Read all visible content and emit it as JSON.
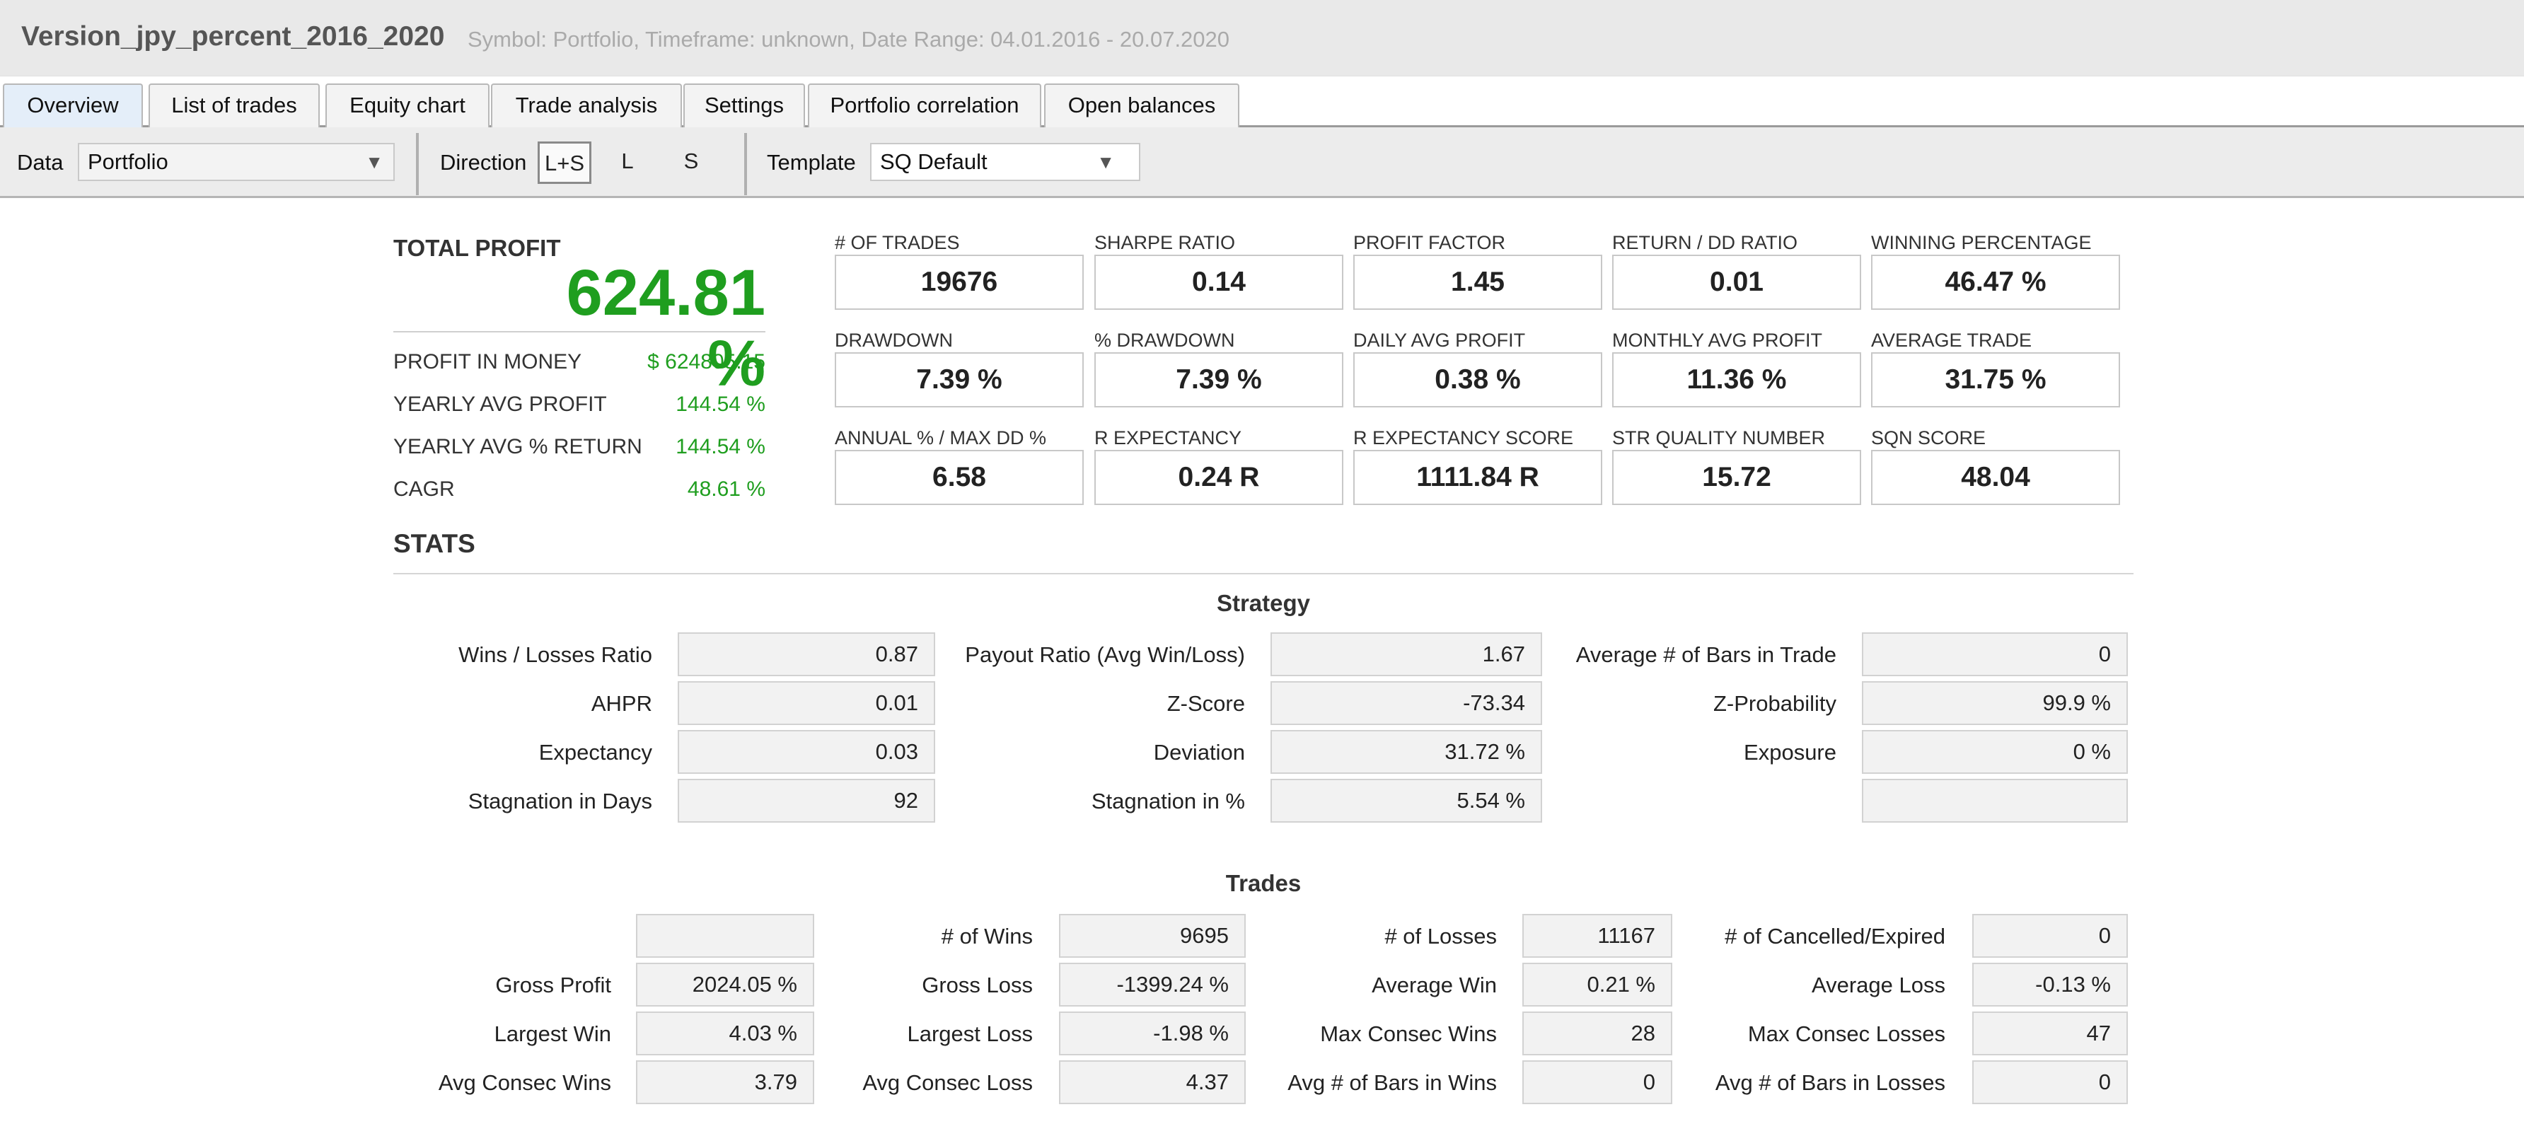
{
  "title": {
    "main": "Version_jpy_percent_2016_2020",
    "subtitle": "Symbol: Portfolio, Timeframe: unknown, Date Range: 04.01.2016 - 20.07.2020"
  },
  "tabs": [
    {
      "label": "Overview",
      "active": true
    },
    {
      "label": "List of trades",
      "active": false
    },
    {
      "label": "Equity chart",
      "active": false
    },
    {
      "label": "Trade analysis",
      "active": false
    },
    {
      "label": "Settings",
      "active": false
    },
    {
      "label": "Portfolio correlation",
      "active": false
    },
    {
      "label": "Open balances",
      "active": false
    }
  ],
  "toolbar": {
    "data_label": "Data",
    "data_value": "Portfolio",
    "direction_label": "Direction",
    "direction_options": [
      "L+S",
      "L",
      "S"
    ],
    "direction_selected": "L+S",
    "template_label": "Template",
    "template_value": "SQ Default",
    "arrow_glyph": "▼"
  },
  "summary": {
    "total_profit_label": "TOTAL PROFIT",
    "total_profit_value": "624.81 %",
    "rows": [
      {
        "label": "PROFIT IN MONEY",
        "value": "$ 624805.15"
      },
      {
        "label": "YEARLY AVG PROFIT",
        "value": "144.54 %"
      },
      {
        "label": "YEARLY AVG % RETURN",
        "value": "144.54 %"
      },
      {
        "label": "CAGR",
        "value": "48.61 %"
      }
    ]
  },
  "metrics": [
    {
      "label": "# OF TRADES",
      "value": "19676"
    },
    {
      "label": "SHARPE RATIO",
      "value": "0.14"
    },
    {
      "label": "PROFIT FACTOR",
      "value": "1.45"
    },
    {
      "label": "RETURN / DD RATIO",
      "value": "0.01"
    },
    {
      "label": "WINNING PERCENTAGE",
      "value": "46.47 %"
    },
    {
      "label": "DRAWDOWN",
      "value": "7.39 %"
    },
    {
      "label": "% DRAWDOWN",
      "value": "7.39 %"
    },
    {
      "label": "DAILY AVG PROFIT",
      "value": "0.38 %"
    },
    {
      "label": "MONTHLY AVG PROFIT",
      "value": "11.36 %"
    },
    {
      "label": "AVERAGE TRADE",
      "value": "31.75 %"
    },
    {
      "label": "ANNUAL % / MAX DD %",
      "value": "6.58"
    },
    {
      "label": "R EXPECTANCY",
      "value": "0.24 R"
    },
    {
      "label": "R EXPECTANCY SCORE",
      "value": "1111.84 R"
    },
    {
      "label": "STR QUALITY NUMBER",
      "value": "15.72"
    },
    {
      "label": "SQN SCORE",
      "value": "48.04"
    }
  ],
  "stats": {
    "title": "STATS",
    "strategy": {
      "title": "Strategy",
      "rows": [
        [
          {
            "label": "Wins / Losses Ratio",
            "value": "0.87"
          },
          {
            "label": "Payout Ratio (Avg Win/Loss)",
            "value": "1.67"
          },
          {
            "label": "Average # of Bars in Trade",
            "value": "0"
          }
        ],
        [
          {
            "label": "AHPR",
            "value": "0.01"
          },
          {
            "label": "Z-Score",
            "value": "-73.34"
          },
          {
            "label": "Z-Probability",
            "value": "99.9 %"
          }
        ],
        [
          {
            "label": "Expectancy",
            "value": "0.03"
          },
          {
            "label": "Deviation",
            "value": "31.72 %"
          },
          {
            "label": "Exposure",
            "value": "0 %"
          }
        ],
        [
          {
            "label": "Stagnation in Days",
            "value": "92"
          },
          {
            "label": "Stagnation in %",
            "value": "5.54 %"
          },
          {
            "label": "",
            "value": ""
          }
        ]
      ]
    },
    "trades": {
      "title": "Trades",
      "rows": [
        [
          {
            "label": "",
            "value": ""
          },
          {
            "label": "# of Wins",
            "value": "9695"
          },
          {
            "label": "# of Losses",
            "value": "11167"
          },
          {
            "label": "# of Cancelled/Expired",
            "value": "0"
          }
        ],
        [
          {
            "label": "Gross Profit",
            "value": "2024.05 %"
          },
          {
            "label": "Gross Loss",
            "value": "-1399.24 %"
          },
          {
            "label": "Average Win",
            "value": "0.21 %"
          },
          {
            "label": "Average Loss",
            "value": "-0.13 %"
          }
        ],
        [
          {
            "label": "Largest Win",
            "value": "4.03 %"
          },
          {
            "label": "Largest Loss",
            "value": "-1.98 %"
          },
          {
            "label": "Max Consec Wins",
            "value": "28"
          },
          {
            "label": "Max Consec Losses",
            "value": "47"
          }
        ],
        [
          {
            "label": "Avg Consec Wins",
            "value": "3.79"
          },
          {
            "label": "Avg Consec Loss",
            "value": "4.37"
          },
          {
            "label": "Avg # of Bars in Wins",
            "value": "0"
          },
          {
            "label": "Avg # of Bars in Losses",
            "value": "0"
          }
        ]
      ]
    }
  }
}
